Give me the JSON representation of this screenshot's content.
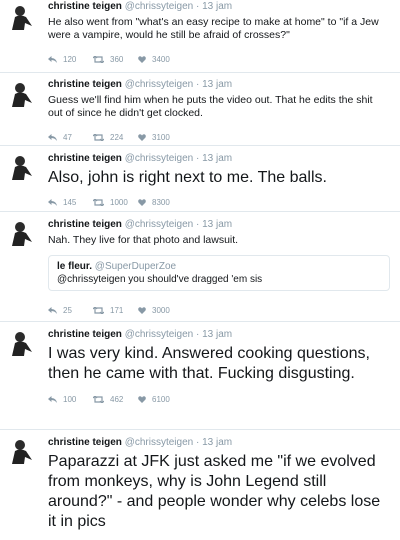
{
  "tweets": [
    {
      "name": "christine teigen",
      "handle": "@chrissyteigen",
      "time": "13 jam",
      "text": "He also went from \"what's an easy recipe to make at home\" to \"if a Jew were a vampire, would he still be afraid of crosses?\"",
      "replies": "120",
      "retweets": "360",
      "likes": "3400"
    },
    {
      "name": "christine teigen",
      "handle": "@chrissyteigen",
      "time": "13 jam",
      "text": "Guess we'll find him when he puts the video out. That he edits the shit out of since he didn't get clocked.",
      "replies": "47",
      "retweets": "224",
      "likes": "3100"
    },
    {
      "name": "christine teigen",
      "handle": "@chrissyteigen",
      "time": "13 jam",
      "text": "Also, john is right next to me. The balls.",
      "replies": "145",
      "retweets": "1000",
      "likes": "8300"
    },
    {
      "name": "christine teigen",
      "handle": "@chrissyteigen",
      "time": "13 jam",
      "text": "Nah. They live for that photo and lawsuit.",
      "quote": {
        "name": "le fleur.",
        "handle": "@SuperDuperZoe",
        "text": "@chrissyteigen you should've dragged 'em sis"
      },
      "replies": "25",
      "retweets": "171",
      "likes": "3000"
    },
    {
      "name": "christine teigen",
      "handle": "@chrissyteigen",
      "time": "13 jam",
      "text": "I was very kind. Answered cooking questions, then he came with that. Fucking disgusting.",
      "replies": "100",
      "retweets": "462",
      "likes": "6100"
    },
    {
      "name": "christine teigen",
      "handle": "@chrissyteigen",
      "time": "13 jam",
      "text": "Paparazzi at JFK just asked me \"if we evolved from monkeys, why is John Legend still around?\" - and people wonder why celebs lose it in pics"
    }
  ]
}
